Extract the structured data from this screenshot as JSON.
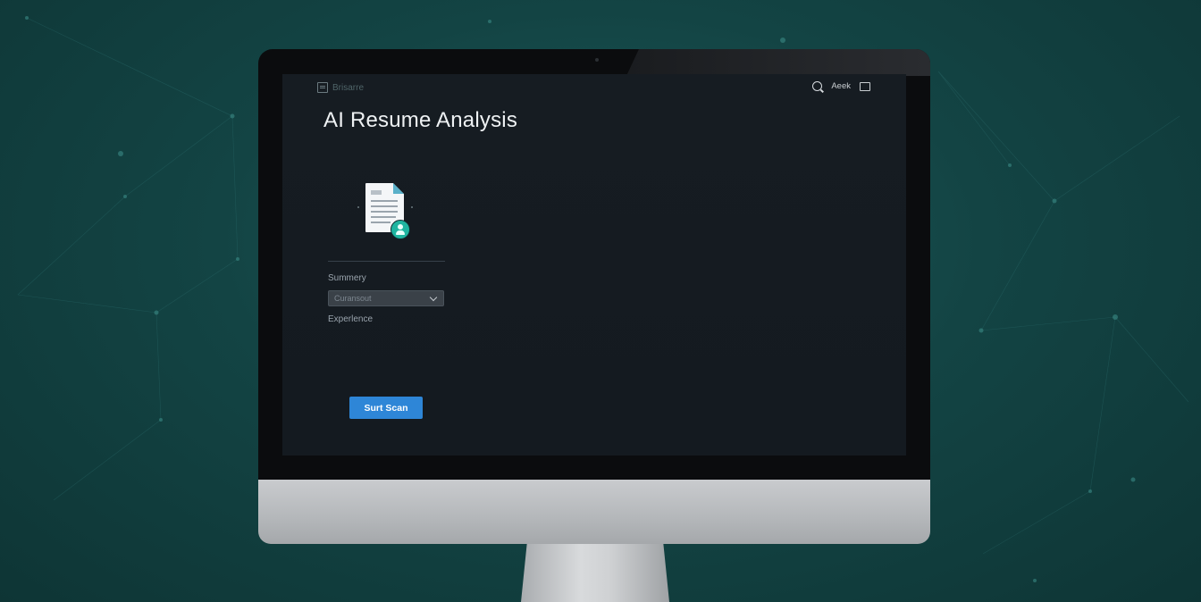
{
  "header": {
    "brand_label": "Brisarre",
    "nav_label": "Aeek"
  },
  "main": {
    "title": "AI Resume Analysis",
    "sections": {
      "summary_label": "Summery",
      "dropdown_value": "Curansout",
      "experience_label": "Experlence"
    },
    "scan_button_label": "Surt Scan"
  },
  "icons": {
    "brand": "document-icon",
    "search": "search-icon",
    "window": "window-icon",
    "resume": "resume-document-icon",
    "user_badge": "user-icon",
    "dropdown": "chevron-down-icon"
  },
  "colors": {
    "background": "#134444",
    "screen": "#161c22",
    "accent_button": "#2e86d7",
    "user_badge": "#1fb4a0",
    "title_text": "#eef1f3"
  }
}
